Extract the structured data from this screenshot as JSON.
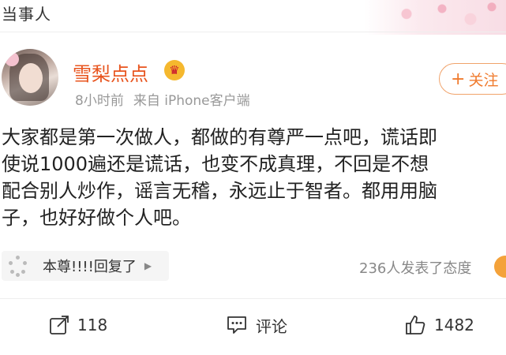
{
  "header": {
    "title": "当事人"
  },
  "user": {
    "name": "雪梨点点",
    "time": "8小时前",
    "source": "来自 iPhone客户端",
    "follow_label": "关注"
  },
  "post": {
    "lines": [
      "大家都是第一次做人，都做的有尊严一点吧，谎话即",
      "使说1000遍还是谎话，也变不成真理，不回是不想",
      "配合别人炒作，谣言无稽，永远止于智者。都用用脑",
      "子，也好好做个人吧。"
    ]
  },
  "repost_chip": {
    "label": "本尊!!!!回复了"
  },
  "attitudes_text": "236人发表了态度",
  "actions": {
    "share_count": "118",
    "comment_label": "评论",
    "like_count": "1482"
  },
  "colors": {
    "name": "#e8541e",
    "follow": "#f07b2e",
    "muted": "#999999"
  }
}
